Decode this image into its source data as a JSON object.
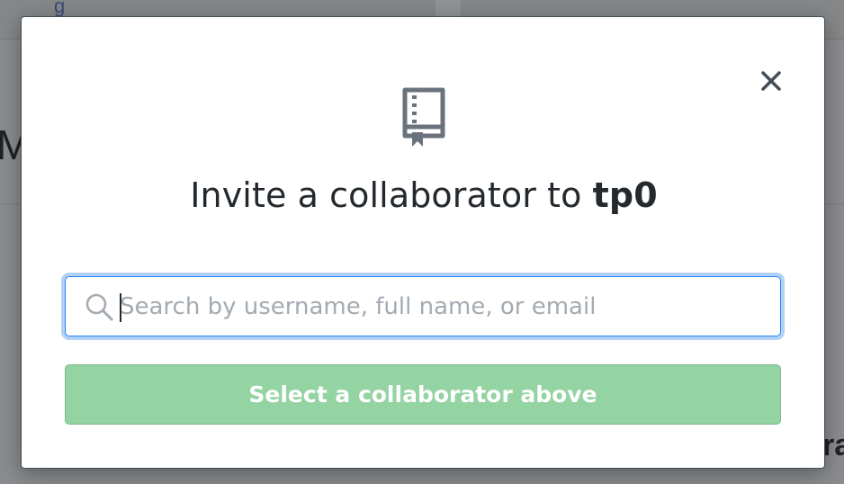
{
  "background": {
    "partial_link_text": "g",
    "partial_heading_text": "M",
    "partial_bottom_text": "ra"
  },
  "modal": {
    "title_prefix": "Invite a collaborator to ",
    "repo_name": "tp0",
    "close_icon": "close-icon",
    "repo_icon": "repo-icon",
    "search": {
      "icon": "search-icon",
      "value": "",
      "placeholder": "Search by username, full name, or email"
    },
    "submit_label": "Select a collaborator above",
    "submit_disabled": true
  },
  "colors": {
    "accent_focus": "#2188ff",
    "button_disabled_green": "#94d3a2",
    "text": "#24292e",
    "icon_gray": "#6a737d"
  }
}
